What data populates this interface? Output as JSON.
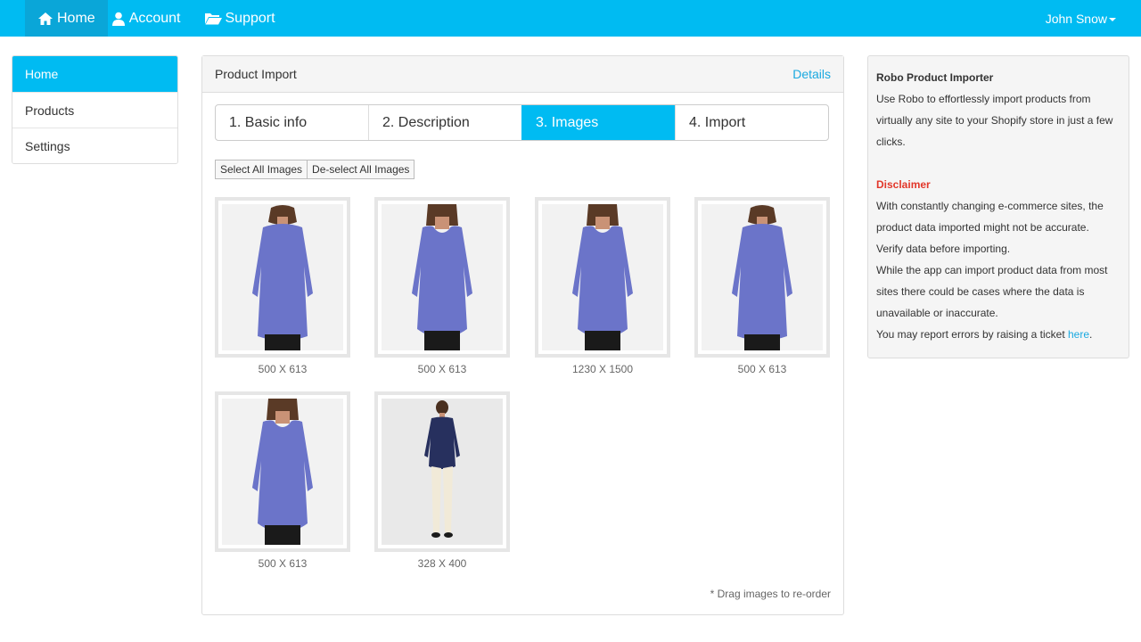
{
  "navbar": {
    "home_label": "Home",
    "account_label": "Account",
    "support_label": "Support",
    "user_name": "John Snow",
    "bg_color": "#00bbf2"
  },
  "sidebar": {
    "items": [
      {
        "label": "Home",
        "active": true
      },
      {
        "label": "Products",
        "active": false
      },
      {
        "label": "Settings",
        "active": false
      }
    ]
  },
  "panel": {
    "title": "Product Import",
    "details_link": "Details",
    "steps": [
      {
        "label": "1. Basic info",
        "active": false
      },
      {
        "label": "2. Description",
        "active": false
      },
      {
        "label": "3. Images",
        "active": true
      },
      {
        "label": "4. Import",
        "active": false
      }
    ],
    "select_all": "Select All Images",
    "deselect_all": "De-select All Images",
    "images": [
      {
        "dimensions": "500 X 613",
        "shirt_color": "#6b74c9",
        "view": "back"
      },
      {
        "dimensions": "500 X 613",
        "shirt_color": "#6b74c9",
        "view": "front"
      },
      {
        "dimensions": "1230 X 1500",
        "shirt_color": "#6b74c9",
        "view": "front"
      },
      {
        "dimensions": "500 X 613",
        "shirt_color": "#6b74c9",
        "view": "back"
      },
      {
        "dimensions": "500 X 613",
        "shirt_color": "#6b74c9",
        "view": "front"
      },
      {
        "dimensions": "328 X 400",
        "shirt_color": "#27305e",
        "view": "full-body"
      }
    ],
    "drag_note": "* Drag images to re-order"
  },
  "info": {
    "title": "Robo Product Importer",
    "intro": "Use Robo to effortlessly import products from virtually any site to your Shopify store in just a few clicks.",
    "disclaimer_heading": "Disclaimer",
    "disclaimer_1": "With constantly changing e-commerce sites, the product data imported might not be accurate.",
    "disclaimer_2": "Verify data before importing.",
    "disclaimer_3": "While the app can import product data from most sites there could be cases where the data is unavailable or inaccurate.",
    "report_text": "You may report errors by raising a ticket",
    "report_link": "here",
    "report_end": "."
  }
}
